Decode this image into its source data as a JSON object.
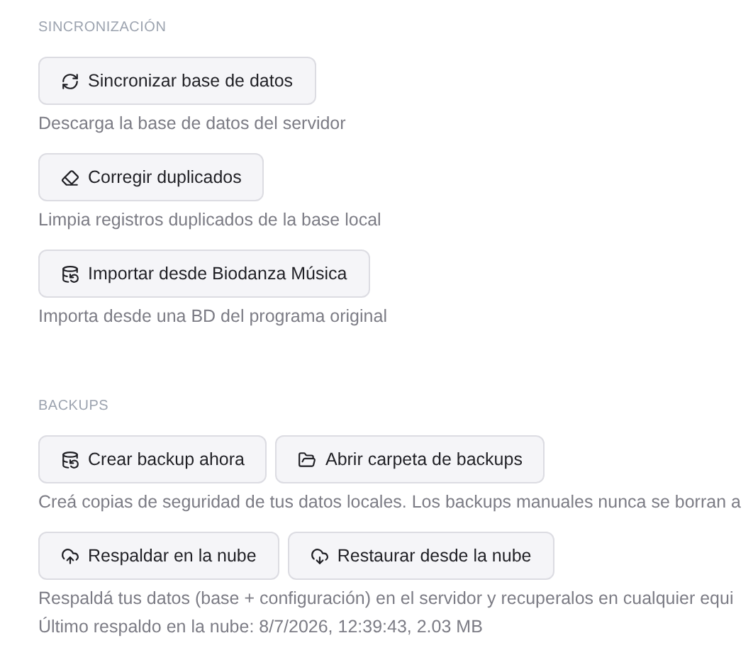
{
  "sections": [
    {
      "title": "SINCRONIZACIÓN",
      "groups": [
        {
          "buttons": [
            "Sincronizar base de datos"
          ],
          "notes": [
            "Descarga la base de datos del servidor"
          ]
        },
        {
          "buttons": [
            "Corregir duplicados"
          ],
          "notes": [
            "Limpia registros duplicados de la base local"
          ]
        },
        {
          "buttons": [
            "Importar desde Biodanza Música"
          ],
          "notes": [
            "Importa desde una BD del programa original"
          ]
        }
      ]
    },
    {
      "title": "BACKUPS",
      "groups": [
        {
          "buttons": [
            "Crear backup ahora",
            "Abrir carpeta de backups"
          ],
          "notes": [
            "Creá copias de seguridad de tus datos locales. Los backups manuales nunca se borran a"
          ]
        },
        {
          "buttons": [
            "Respaldar en la nube",
            "Restaurar desde la nube"
          ],
          "notes": [
            "Respaldá tus datos (base + configuración) en el servidor y recuperalos en cualquier equi",
            "Último respaldo en la nube: 8/7/2026, 12:39:43, 2.03 MB"
          ]
        }
      ]
    }
  ]
}
